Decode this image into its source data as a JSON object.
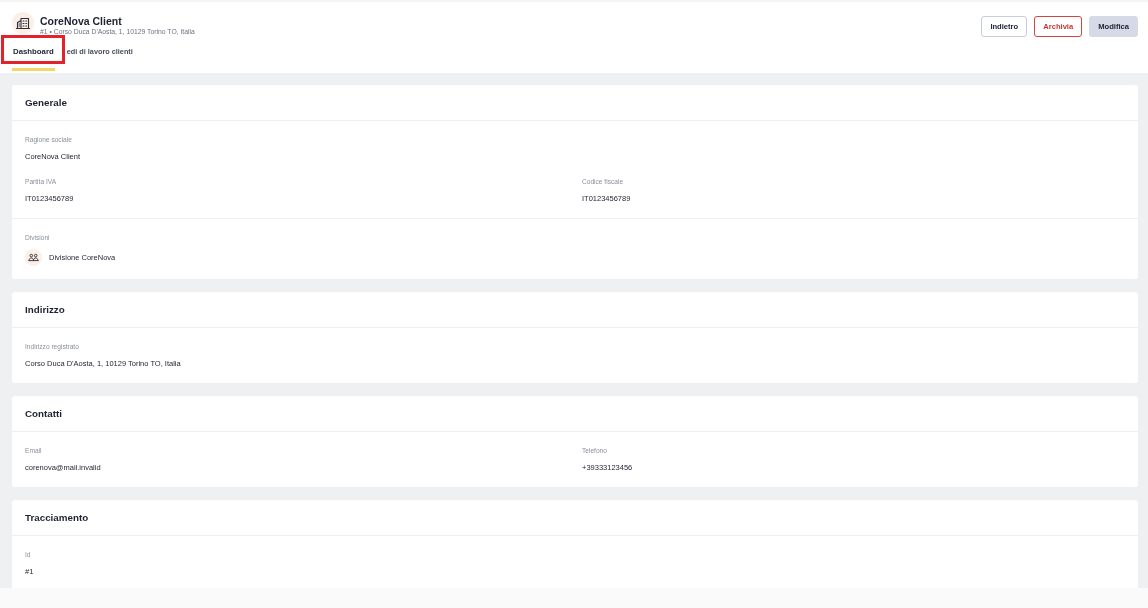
{
  "header": {
    "title": "CoreNova Client",
    "subtitle": "#1 • Corso Duca D'Aosta, 1, 10129 Torino TO, Italia"
  },
  "actions": [
    {
      "label": "Indietro",
      "kind": "default"
    },
    {
      "label": "Archivia",
      "kind": "danger"
    },
    {
      "label": "Modifica",
      "kind": "primary"
    }
  ],
  "tabs": [
    {
      "label": "Dashboard",
      "selected": true,
      "highlighted": true
    },
    {
      "label": "edi di lavoro clienti",
      "selected": false,
      "highlighted": false
    }
  ],
  "sections": [
    {
      "title": "Generale",
      "groups": [
        {
          "rows": [
            [
              {
                "kind": "text",
                "label": "Ragione sociale",
                "value": "CoreNova Client"
              }
            ],
            [
              {
                "kind": "text",
                "label": "Partita IVA",
                "value": "IT0123456789"
              },
              {
                "kind": "text",
                "label": "Codice fiscale",
                "value": "IT0123456789"
              }
            ]
          ]
        },
        {
          "rows": [
            [
              {
                "kind": "list",
                "label": "Divisioni",
                "items": [
                  "Divisione CoreNova"
                ]
              }
            ]
          ]
        }
      ]
    },
    {
      "title": "Indirizzo",
      "groups": [
        {
          "rows": [
            [
              {
                "kind": "text",
                "label": "Indirizzo registrato",
                "value": "Corso Duca D'Aosta, 1, 10129 Torino TO, Italia"
              }
            ]
          ]
        }
      ]
    },
    {
      "title": "Contatti",
      "groups": [
        {
          "rows": [
            [
              {
                "kind": "text",
                "label": "Email",
                "value": "corenova@mail.invalid"
              },
              {
                "kind": "text",
                "label": "Telefono",
                "value": "+39333123456"
              }
            ]
          ]
        }
      ]
    },
    {
      "title": "Tracciamento",
      "groups": [
        {
          "rows": [
            [
              {
                "kind": "text",
                "label": "Id",
                "value": "#1"
              }
            ]
          ]
        }
      ]
    }
  ]
}
